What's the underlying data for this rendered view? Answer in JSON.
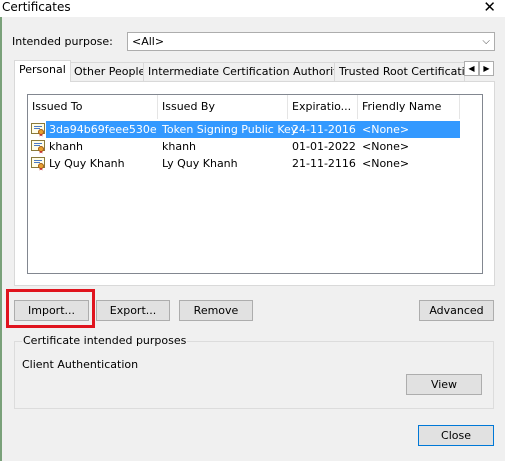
{
  "window": {
    "title": "Certificates"
  },
  "purpose": {
    "label": "Intended purpose:",
    "value": "<All>"
  },
  "tabs": [
    {
      "label": "Personal"
    },
    {
      "label": "Other People"
    },
    {
      "label": "Intermediate Certification Authorities"
    },
    {
      "label": "Trusted Root Certification"
    }
  ],
  "list": {
    "columns": [
      "Issued To",
      "Issued By",
      "Expiratio...",
      "Friendly Name"
    ],
    "rows": [
      {
        "issued_to": "3da94b69feee530e",
        "issued_by": "Token Signing Public Key",
        "expiration": "24-11-2016",
        "friendly_name": "<None>"
      },
      {
        "issued_to": "khanh",
        "issued_by": "khanh",
        "expiration": "01-01-2022",
        "friendly_name": "<None>"
      },
      {
        "issued_to": "Ly Quy Khanh",
        "issued_by": "Ly Quy Khanh",
        "expiration": "21-11-2116",
        "friendly_name": "<None>"
      }
    ]
  },
  "buttons": {
    "import": "Import...",
    "export": "Export...",
    "remove": "Remove",
    "advanced": "Advanced",
    "view": "View",
    "close": "Close"
  },
  "purposes_group": {
    "legend": "Certificate intended purposes",
    "text": "Client Authentication"
  },
  "colors": {
    "selection": "#3399ff",
    "highlight_box": "#e0141e"
  }
}
